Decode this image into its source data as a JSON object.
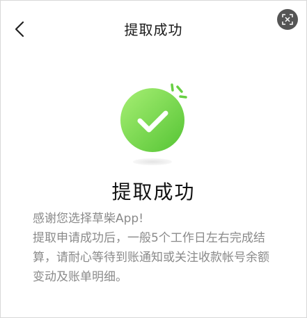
{
  "header": {
    "title": "提取成功"
  },
  "icons": {
    "back": "chevron-left-icon",
    "capture": "screen-capture-icon",
    "success": "check-circle-icon"
  },
  "colors": {
    "success_green_light": "#9bea6a",
    "success_green_dark": "#5cc93a",
    "text_primary": "#111111",
    "text_secondary": "#8a8a8a"
  },
  "main": {
    "heading": "提取成功",
    "line1": "感谢您选择草柴App!",
    "line2": "提取申请成功后，一般5个工作日左右完成结算，请耐心等待到账通知或关注收款帐号余额变动及账单明细。"
  }
}
